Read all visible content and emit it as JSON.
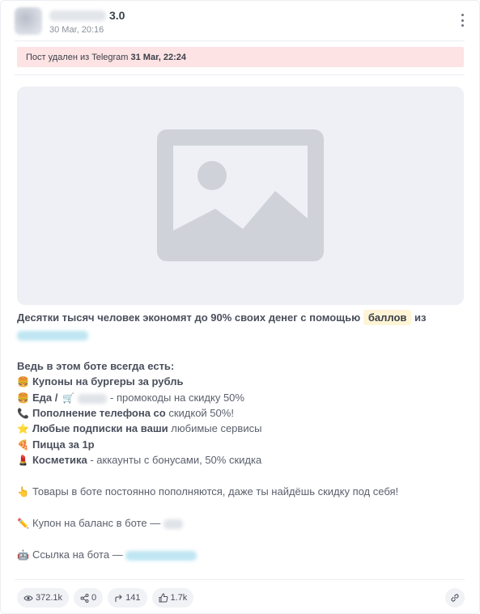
{
  "post": {
    "channel_suffix": "3.0",
    "date": "30 Мar, 20:16"
  },
  "banner": {
    "text": "Пост удален из Telegram",
    "date": "31 Мar, 22:24"
  },
  "body": {
    "intro_part1": "Десятки тысяч человек экономят до 90% своих денег с помощью",
    "intro_highlight": "баллов",
    "intro_part2": "из",
    "list_heading": "Ведь в этом боте всегда есть:",
    "items": [
      {
        "icon": "burger-icon",
        "glyph": "🍔",
        "bold": "Купоны на бургеры за рубль",
        "rest": ""
      },
      {
        "icon": "burger-icon",
        "glyph": "🍔",
        "bold": "Еда /",
        "icon2": "cart-icon",
        "glyph2": "🛒",
        "rest": "- промокоды на скидку 50%"
      },
      {
        "icon": "phone-icon",
        "glyph": "📞",
        "bold": "Пополнение телефона со",
        "rest": "скидкой 50%!"
      },
      {
        "icon": "star-icon",
        "glyph": "⭐",
        "bold": "Любые подписки на ваши",
        "rest": "любимые сервисы"
      },
      {
        "icon": "pizza-icon",
        "glyph": "🍕",
        "bold": "Пицца за 1р",
        "rest": ""
      },
      {
        "icon": "lipstick-icon",
        "glyph": "💄",
        "bold": "Косметика",
        "rest": "- аккаунты с бонусами, 50% скидка"
      }
    ],
    "goods_line": "Товары в боте постоянно пополняются, даже ты найдёшь скидку под себя!",
    "coupon_line": "Купон на баланс в боте —",
    "bot_link_line": "Ссылка на бота —"
  },
  "footer": {
    "views": "372.1k",
    "shares": "0",
    "forwards": "141",
    "reactions": "1.7k"
  },
  "colors": {
    "banner_bg": "#fde3e3",
    "highlight_bg": "#fff5d6",
    "placeholder_bg": "#eef0f6",
    "placeholder_icon": "#cfd2d9"
  }
}
